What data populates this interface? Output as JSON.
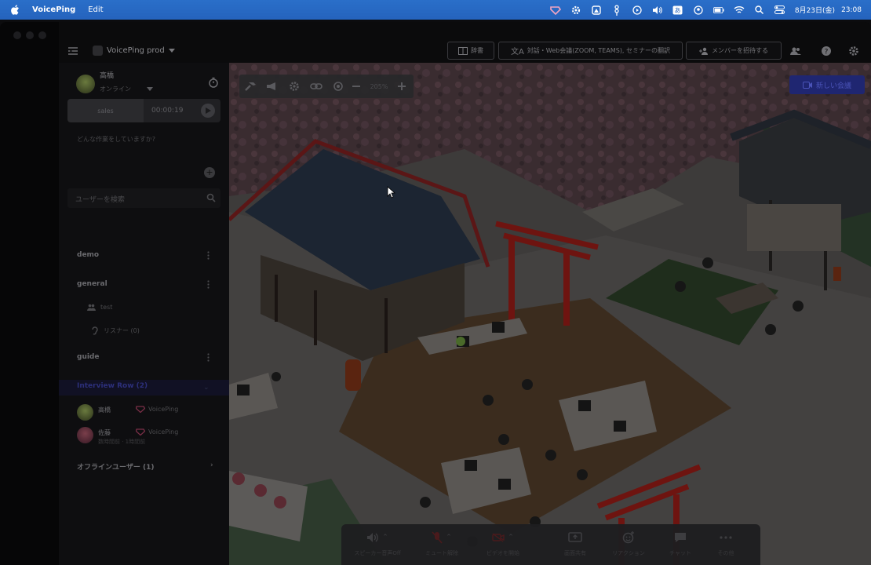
{
  "menubar": {
    "app_name": "VoicePing",
    "menu_edit": "Edit",
    "date": "8月23日(金)",
    "time": "23:08",
    "icons": [
      "voiceping-tray-icon",
      "gear-icon",
      "drive-icon",
      "tree-icon",
      "play-circle-icon",
      "volume-icon",
      "input-method-icon",
      "user-circle-icon",
      "battery-icon",
      "wifi-icon",
      "search-icon",
      "control-center-icon"
    ]
  },
  "header": {
    "workspace": "VoicePing prod",
    "btn_dictionary": "辞書",
    "btn_translate": "対話・Web会議(ZOOM, TEAMS), セミナーの翻訳",
    "btn_invite": "メンバーを招待する"
  },
  "me": {
    "name": "高橋",
    "status": "オンライン",
    "task_label": "sales",
    "timer": "00:00:19",
    "what_doing_placeholder": "どんな作業をしていますか?"
  },
  "search": {
    "placeholder": "ユーザーを検索"
  },
  "channels": {
    "demo": "demo",
    "general": "general",
    "general_sub1": "test",
    "general_sub2": "リスナー (0)",
    "guide": "guide",
    "interview": "Interview Row (2)"
  },
  "members": [
    {
      "name": "高橋",
      "org": "VoicePing",
      "sub": ""
    },
    {
      "name": "佐藤",
      "org": "VoicePing",
      "sub": "数時間前 · 1時間前"
    }
  ],
  "offline": "オフラインユーザー (1)",
  "map": {
    "zoom": "205%",
    "new_meeting": "新しい会議"
  },
  "controls": [
    {
      "label": "スピーカー音声Off",
      "icon": "speaker-icon"
    },
    {
      "label": "ミュート解除",
      "icon": "mic-muted-icon"
    },
    {
      "label": "ビデオを開始",
      "icon": "video-off-icon"
    },
    {
      "label": "画面共有",
      "icon": "screen-share-icon"
    },
    {
      "label": "リアクション",
      "icon": "emoji-icon"
    },
    {
      "label": "チャット",
      "icon": "chat-icon"
    },
    {
      "label": "その他",
      "icon": "more-icon"
    }
  ],
  "colors": {
    "menubar": "#2563bd",
    "new_meeting_bg": "#1f2671",
    "active_channel": "#2c2f7a",
    "torii_red": "#6e1410"
  }
}
